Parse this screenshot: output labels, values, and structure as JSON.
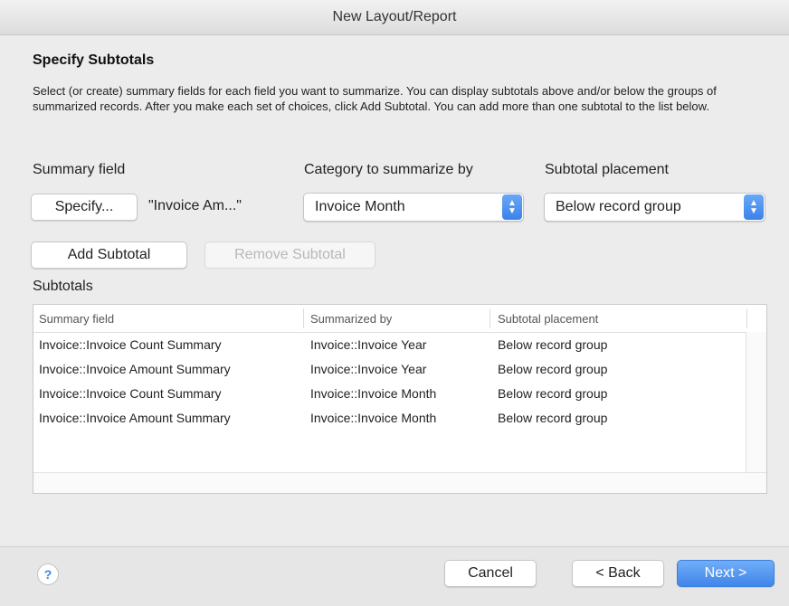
{
  "window": {
    "title": "New Layout/Report"
  },
  "section": {
    "heading": "Specify Subtotals",
    "description": "Select (or create) summary fields for each field you want to summarize. You can display subtotals above and/or below the groups of summarized records. After you make each set of choices, click Add Subtotal. You can add more than one subtotal to the list below."
  },
  "summary_field": {
    "label": "Summary field",
    "specify_button": "Specify...",
    "value": "\"Invoice Am...\""
  },
  "category": {
    "label": "Category to summarize by",
    "selected": "Invoice Month"
  },
  "placement": {
    "label": "Subtotal placement",
    "selected": "Below record group"
  },
  "actions": {
    "add_subtotal": "Add Subtotal",
    "remove_subtotal": "Remove Subtotal"
  },
  "subtotals": {
    "label": "Subtotals",
    "columns": [
      "Summary field",
      "Summarized by",
      "Subtotal placement"
    ],
    "rows": [
      [
        "Invoice::Invoice Count Summary",
        "Invoice::Invoice Year",
        "Below record group"
      ],
      [
        "Invoice::Invoice Amount Summary",
        "Invoice::Invoice Year",
        "Below record group"
      ],
      [
        "Invoice::Invoice Count Summary",
        "Invoice::Invoice Month",
        "Below record group"
      ],
      [
        "Invoice::Invoice Amount Summary",
        "Invoice::Invoice Month",
        "Below record group"
      ]
    ]
  },
  "footer": {
    "help_icon": "question-mark",
    "help_glyph": "?",
    "cancel": "Cancel",
    "back": "< Back",
    "next": "Next >"
  },
  "colors": {
    "accent": "#3f85ea",
    "window_bg": "#ececec"
  }
}
